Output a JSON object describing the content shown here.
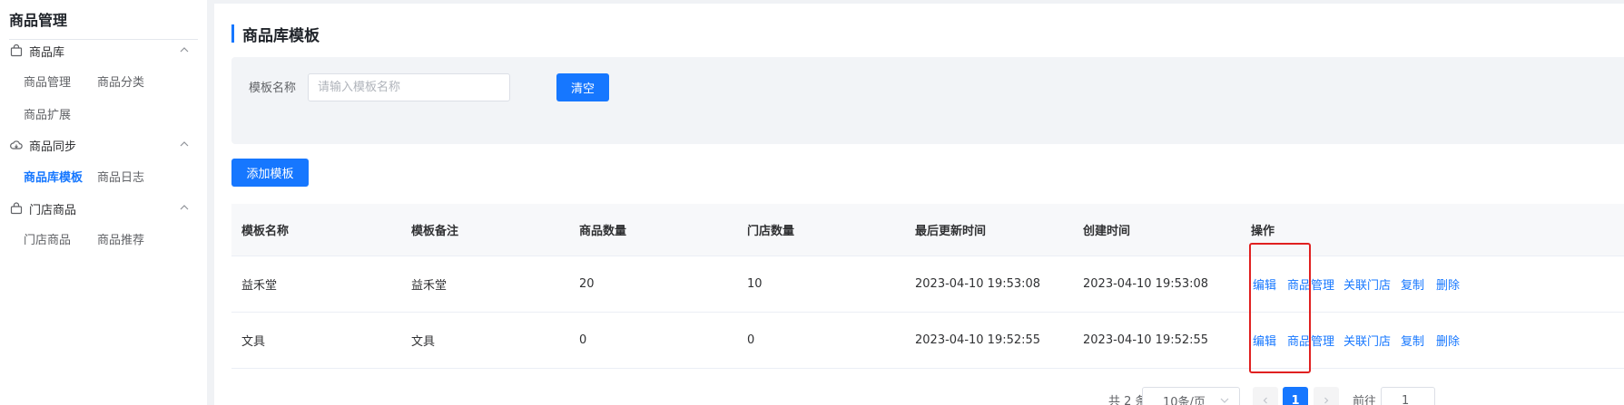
{
  "sidebar": {
    "title": "商品管理",
    "groups": [
      {
        "label": "商品库",
        "icon": "bag-icon",
        "items": [
          {
            "label": "商品管理"
          },
          {
            "label": "商品分类"
          },
          {
            "label": "商品扩展"
          }
        ]
      },
      {
        "label": "商品同步",
        "icon": "cloud-sync-icon",
        "items": [
          {
            "label": "商品库模板",
            "active": true
          },
          {
            "label": "商品日志"
          }
        ]
      },
      {
        "label": "门店商品",
        "icon": "lock-bag-icon",
        "items": [
          {
            "label": "门店商品"
          },
          {
            "label": "商品推荐"
          }
        ]
      }
    ]
  },
  "page": {
    "title": "商品库模板"
  },
  "filter": {
    "label": "模板名称",
    "placeholder": "请输入模板名称",
    "value": "",
    "clear_label": "清空"
  },
  "toolbar": {
    "add_label": "添加模板"
  },
  "table": {
    "columns": [
      "模板名称",
      "模板备注",
      "商品数量",
      "门店数量",
      "最后更新时间",
      "创建时间",
      "操作"
    ],
    "rows": [
      {
        "name": "益禾堂",
        "remark": "益禾堂",
        "product_count": "20",
        "store_count": "10",
        "updated": "2023-04-10 19:53:08",
        "created": "2023-04-10 19:53:08"
      },
      {
        "name": "文具",
        "remark": "文具",
        "product_count": "0",
        "store_count": "0",
        "updated": "2023-04-10 19:52:55",
        "created": "2023-04-10 19:52:55"
      }
    ],
    "actions": [
      "编辑",
      "商品管理",
      "关联门店",
      "复制",
      "删除"
    ]
  },
  "pagination": {
    "total": "共 2 条",
    "page_size": "10条/页",
    "current_page": "1",
    "goto_label": "前往",
    "goto_value": "1"
  },
  "colors": {
    "accent": "#1677ff",
    "highlight": "#e02020"
  }
}
